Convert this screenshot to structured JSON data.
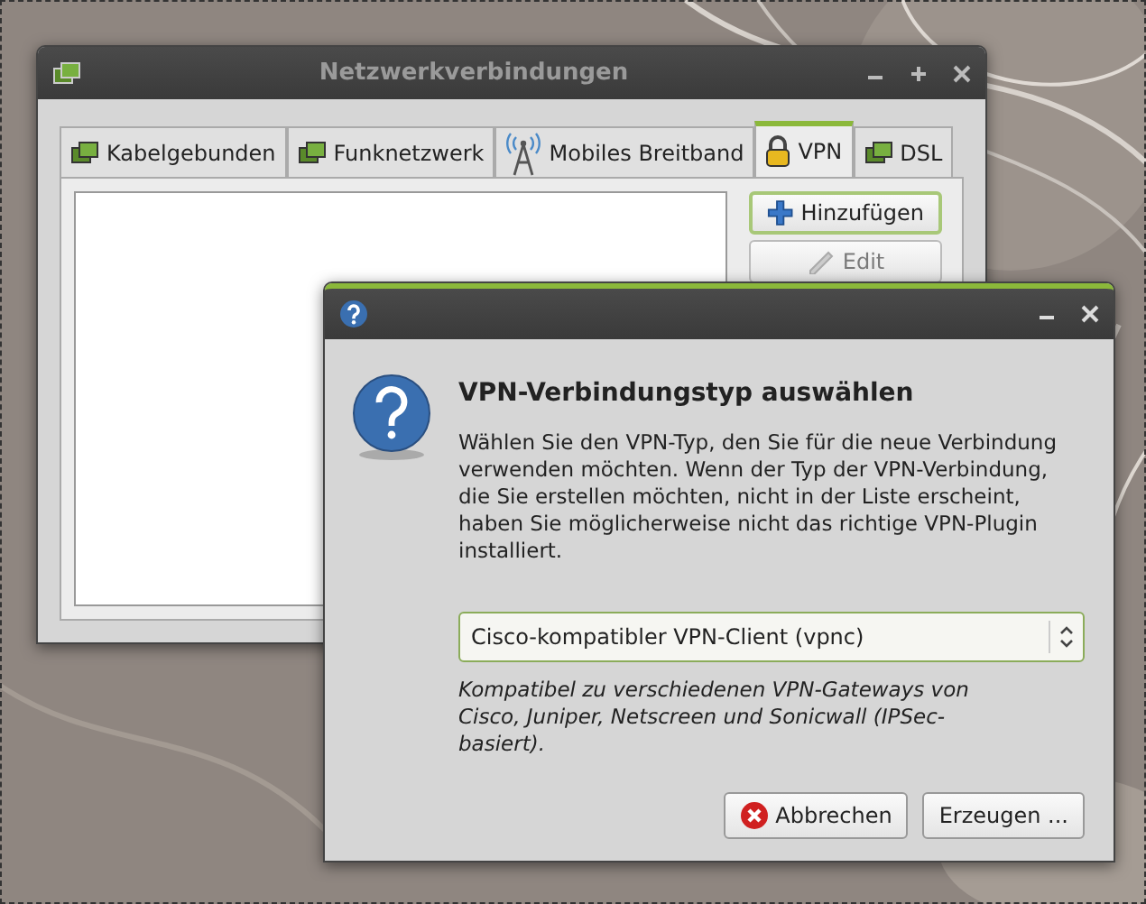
{
  "main_window": {
    "title": "Netzwerkverbindungen",
    "tabs": [
      {
        "label": "Kabelgebunden",
        "kind": "network",
        "selected": false
      },
      {
        "label": "Funknetzwerk",
        "kind": "network",
        "selected": false
      },
      {
        "label": "Mobiles Breitband",
        "kind": "antenna",
        "selected": false
      },
      {
        "label": "VPN",
        "kind": "lock",
        "selected": true
      },
      {
        "label": "DSL",
        "kind": "network",
        "selected": false
      }
    ],
    "buttons": [
      {
        "label": "Hinzufügen",
        "kind": "add",
        "disabled": false
      },
      {
        "label": "Edit",
        "kind": "edit",
        "disabled": true
      }
    ]
  },
  "dialog": {
    "heading": "VPN-Verbindungstyp auswählen",
    "message": "Wählen Sie den VPN-Typ, den Sie für die neue Verbindung verwenden möchten. Wenn der Typ der VPN-Verbindung, die Sie erstellen möchten, nicht in der Liste erscheint, haben Sie möglicherweise nicht das richtige VPN-Plugin installiert.",
    "vpn_type": {
      "value": "Cisco-kompatibler VPN-Client (vpnc)"
    },
    "description": "Kompatibel zu verschiedenen VPN-Gateways von Cisco, Juniper, Netscreen und Sonicwall (IPSec-basiert).",
    "buttons": [
      {
        "label": "Abbrechen",
        "kind": "cancel"
      },
      {
        "label": "Erzeugen ...",
        "kind": "plain"
      }
    ]
  }
}
